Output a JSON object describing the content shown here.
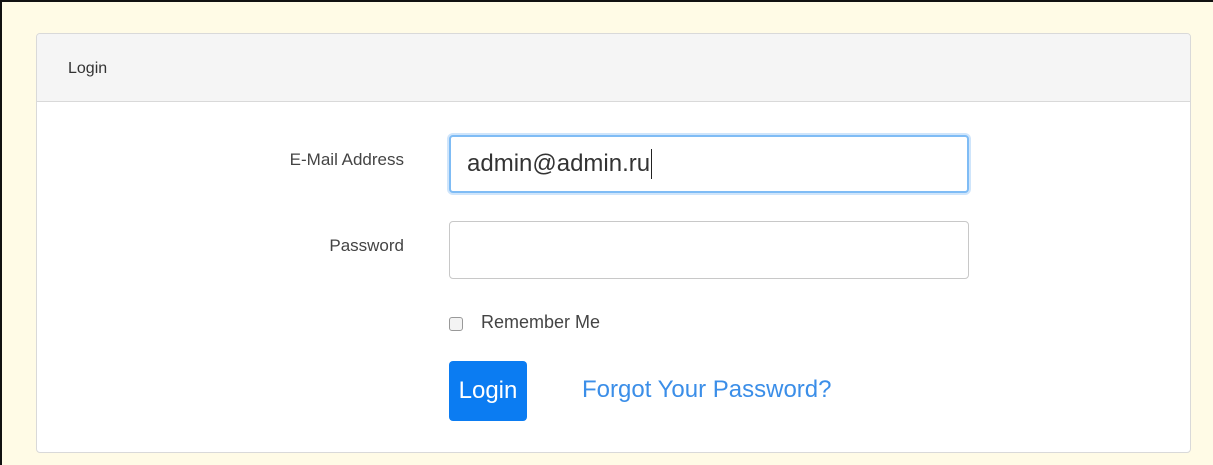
{
  "panel": {
    "title": "Login"
  },
  "form": {
    "email_label": "E-Mail Address",
    "email_value": "admin@admin.ru",
    "password_label": "Password",
    "password_value": "",
    "remember_label": "Remember Me",
    "remember_checked": false,
    "login_label": "Login",
    "forgot_label": "Forgot Your Password?"
  },
  "colors": {
    "page_background": "#fffbe6",
    "primary_button": "#0b7cf2",
    "link": "#3b8ee8",
    "focus_ring": "#7fbcf5"
  }
}
